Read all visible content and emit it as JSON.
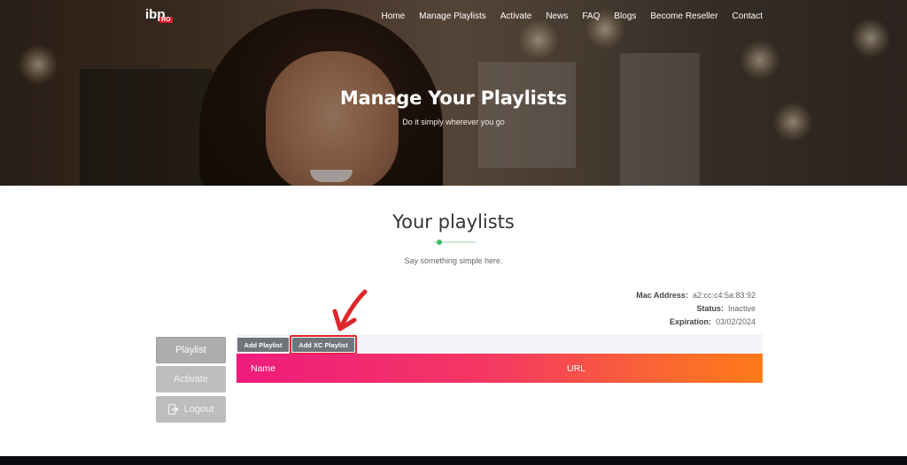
{
  "colors": {
    "accent_green": "#3cbf6a",
    "header_gradient_start": "#ef1b7d",
    "header_gradient_end": "#ff7a1a",
    "highlight_red": "#e0262b"
  },
  "brand": {
    "logo_main": "ibp",
    "logo_badge": "RO"
  },
  "nav": {
    "items": [
      "Home",
      "Manage Playlists",
      "Activate",
      "News",
      "FAQ",
      "Blogs",
      "Become Reseller",
      "Contact"
    ]
  },
  "hero": {
    "title": "Manage Your Playlists",
    "subtitle": "Do it simply wherever you go"
  },
  "section": {
    "title": "Your playlists",
    "subtitle": "Say something simple here."
  },
  "device": {
    "mac_label": "Mac Address:",
    "mac_value": "a2:cc:c4:5a:83:92",
    "status_label": "Status:",
    "status_value": "Inactive",
    "expiration_label": "Expiration:",
    "expiration_value": "03/02/2024"
  },
  "sidebar": {
    "playlist_label": "Playlist",
    "activate_label": "Activate",
    "logout_label": "Logout"
  },
  "toolbar": {
    "add_playlist_label": "Add Playlist",
    "add_xc_label": "Add XC Playlist"
  },
  "table": {
    "columns": [
      "Name",
      "URL"
    ]
  }
}
